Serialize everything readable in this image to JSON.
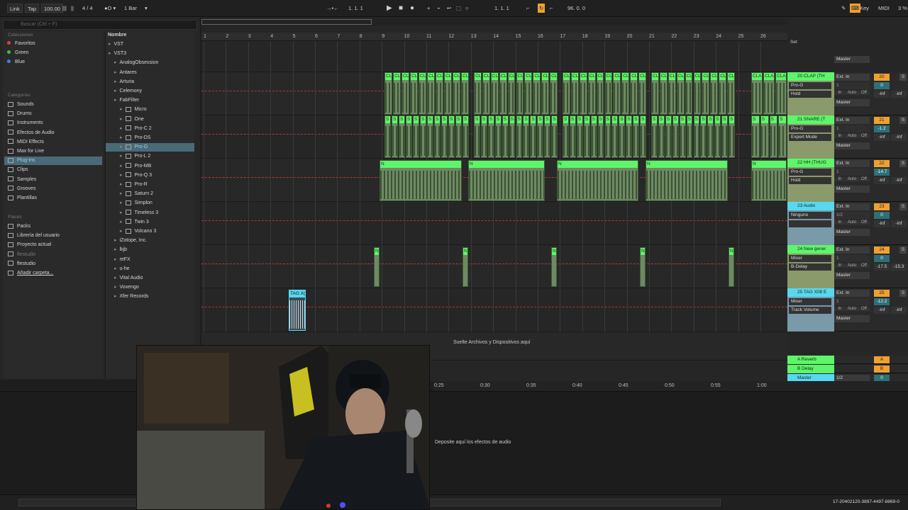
{
  "transport": {
    "link": "Link",
    "tap": "Tap",
    "tempo": "100.00",
    "meter": "4 / 4",
    "quant": "1 Bar",
    "position": "1.   1.   1",
    "loop_start": "1.   1.   1",
    "loop_len": "96.   0.   0",
    "key": "Key",
    "midi": "MIDI",
    "cpu": "3 %"
  },
  "browser": {
    "search_placeholder": "Buscar (Ctrl + F)",
    "colecciones_header": "Colecciones",
    "collections": [
      {
        "label": "Favoritos",
        "color": "#e04040"
      },
      {
        "label": "Green",
        "color": "#40c040"
      },
      {
        "label": "Blue",
        "color": "#4080e0"
      }
    ],
    "categorias_header": "Categorías",
    "categories": [
      "Sounds",
      "Drums",
      "Instruments",
      "Efectos de Audio",
      "MIDI Effects",
      "Max for Live",
      "Plug-Ins",
      "Clips",
      "Samples",
      "Grooves",
      "Plantillas"
    ],
    "places_header": "Places",
    "places": [
      "Packs",
      "Librería del usuario",
      "Proyecto actual",
      "flestudio",
      "flestudio",
      "Añadir carpeta..."
    ],
    "name_header": "Nombre",
    "tree": [
      {
        "label": "VST",
        "level": 0
      },
      {
        "label": "VST3",
        "level": 0
      },
      {
        "label": "AnalogObsession",
        "level": 1
      },
      {
        "label": "Antares",
        "level": 1
      },
      {
        "label": "Arturia",
        "level": 1
      },
      {
        "label": "Celemony",
        "level": 1
      },
      {
        "label": "FabFilter",
        "level": 1
      },
      {
        "label": "Micro",
        "level": 2
      },
      {
        "label": "One",
        "level": 2
      },
      {
        "label": "Pro-C 2",
        "level": 2
      },
      {
        "label": "Pro-DS",
        "level": 2
      },
      {
        "label": "Pro-G",
        "level": 2
      },
      {
        "label": "Pro-L 2",
        "level": 2
      },
      {
        "label": "Pro-MB",
        "level": 2
      },
      {
        "label": "Pro-Q 3",
        "level": 2
      },
      {
        "label": "Pro-R",
        "level": 2
      },
      {
        "label": "Saturn 2",
        "level": 2
      },
      {
        "label": "Simplon",
        "level": 2
      },
      {
        "label": "Timeless 3",
        "level": 2
      },
      {
        "label": "Twin 3",
        "level": 2
      },
      {
        "label": "Volcano 3",
        "level": 2
      },
      {
        "label": "iZotope, Inc.",
        "level": 1
      },
      {
        "label": "lkjb",
        "level": 1
      },
      {
        "label": "reFX",
        "level": 1
      },
      {
        "label": "u-he",
        "level": 1
      },
      {
        "label": "Vital Audio",
        "level": 1
      },
      {
        "label": "Voxengo",
        "level": 1
      },
      {
        "label": "Xfer Records",
        "level": 1
      }
    ]
  },
  "ruler": [
    "1",
    "2",
    "3",
    "4",
    "5",
    "6",
    "7",
    "8",
    "9",
    "10",
    "11",
    "12",
    "13",
    "14",
    "15",
    "16",
    "17",
    "18",
    "19",
    "20",
    "21",
    "22",
    "23",
    "24",
    "25",
    "26"
  ],
  "arrangement": {
    "drop_hint": "Suelte Archivos y Dispositivos aquí",
    "tag_clip": "TAG X(",
    "clap_label": "CLA",
    "snare_label": "S",
    "hh_label": "N"
  },
  "timebar": [
    "0:25",
    "0:30",
    "0:35",
    "0:40",
    "0:45",
    "0:50",
    "0:55",
    "1:00"
  ],
  "set_label": "Set",
  "tracks": [
    {
      "name": "20 CLAP (TH",
      "color": "#5ef56a",
      "input": "Ext. In",
      "ch": "1",
      "dev1": "Pro-G",
      "dev2": "Hold",
      "out": "Master",
      "num": "20",
      "vol": "0",
      "vol2": "-inf",
      "vol3": "-inf"
    },
    {
      "name": "21 SNARE (T",
      "color": "#5ef56a",
      "input": "Ext. In",
      "ch": "1",
      "dev1": "Pro-G",
      "dev2": "Expert Mode",
      "out": "Master",
      "num": "21",
      "vol": "-1.2",
      "vol2": "-inf",
      "vol3": "-inf"
    },
    {
      "name": "22 HH (THUG",
      "color": "#5ef56a",
      "input": "Ext. In",
      "ch": "1",
      "dev1": "Pro-G",
      "dev2": "Hold",
      "out": "Master",
      "num": "22",
      "vol": "-14.7",
      "vol2": "-inf",
      "vol3": "-inf"
    },
    {
      "name": "23 Audio",
      "color": "#58d8f0",
      "input": "Ext. In",
      "ch": "1/2",
      "dev1": "Ninguno",
      "dev2": "",
      "out": "Master",
      "num": "23",
      "vol": "0",
      "vol2": "-inf",
      "vol3": "-inf"
    },
    {
      "name": "24 New gener",
      "color": "#5ef56a",
      "input": "Ext. In",
      "ch": "1",
      "dev1": "Mixer",
      "dev2": "B-Delay",
      "out": "Master",
      "num": "24",
      "vol": "0",
      "vol2": "-17.5",
      "vol3": "-15.3"
    },
    {
      "name": "25 TAG X08 E",
      "color": "#58d8f0",
      "input": "Ext. In",
      "ch": "1",
      "dev1": "Mixer",
      "dev2": "Track Volume",
      "out": "Master",
      "num": "25",
      "vol": "-12.2",
      "vol2": "-inf",
      "vol3": "-inf"
    }
  ],
  "returns": [
    {
      "name": "A Reverb",
      "num": "A"
    },
    {
      "name": "B Delay",
      "num": "B"
    }
  ],
  "master": {
    "name": "Master",
    "ch": "1/2",
    "vol": "0"
  },
  "master_top": "Master",
  "io_labels": {
    "in": "In",
    "auto": "Auto",
    "off": "Off"
  },
  "detail": {
    "hint": "Deposite aquí los efectos de audio"
  },
  "status": {
    "file": "17-20402120-3897-4497-8869-0"
  }
}
